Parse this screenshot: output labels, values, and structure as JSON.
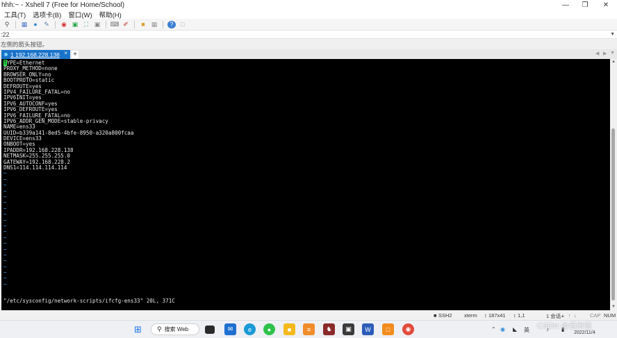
{
  "window": {
    "title": "hhh:~ - Xshell 7 (Free for Home/School)",
    "minimize": "—",
    "maximize": "❐",
    "close": "✕"
  },
  "menu": {
    "items": [
      "工具(T)",
      "选项卡(B)",
      "窗口(W)",
      "帮助(H)"
    ]
  },
  "toolbar": {
    "icons": [
      "search-icon",
      "new-session-icon",
      "globe-icon",
      "properties-icon",
      "xftp-icon",
      "xagent-icon",
      "fullscreen-icon",
      "lock-icon",
      "keyboard-icon",
      "compose-icon",
      "folder-icon",
      "layout-icon",
      "help-icon",
      "chat-icon"
    ]
  },
  "address": {
    "value": ":22"
  },
  "hint": {
    "text": "左侧的箭头按钮。"
  },
  "tabs": [
    {
      "label": "1 192.168.228.138",
      "close": "×"
    }
  ],
  "tab_add": "+",
  "terminal": {
    "cursor_char": "T",
    "first_line_rest": "YPE=Ethernet",
    "lines": [
      "PROXY_METHOD=none",
      "BROWSER_ONLY=no",
      "BOOTPROTO=static",
      "DEFROUTE=yes",
      "IPV4_FAILURE_FATAL=no",
      "IPV6INIT=yes",
      "IPV6_AUTOCONF=yes",
      "IPV6_DEFROUTE=yes",
      "IPV6_FAILURE_FATAL=no",
      "IPV6_ADDR_GEN_MODE=stable-privacy",
      "NAME=ens33",
      "UUID=b339a141-8ed5-4bfe-8950-a320a800fcaa",
      "DEVICE=ens33",
      "ONBOOT=yes",
      "IPADDR=192.168.228.138",
      "NETMASK=255.255.255.0",
      "GATEWAY=192.168.228.2",
      "DNS1=114.114.114.114"
    ],
    "tilde_count": 20,
    "status_message": "\"/etc/sysconfig/network-scripts/ifcfg-ens33\" 20L, 371C"
  },
  "statusbar": {
    "protocol": "SSH2",
    "terminal_type": "xterm",
    "size": "187x41",
    "cursor_pos": "1,1",
    "sessions": "1 会话",
    "caps": "CAP",
    "num": "NUM"
  },
  "taskbar": {
    "search_label": "搜索 Web",
    "ime": "英",
    "date": "2022/11/4",
    "watermark": "CSDN @佰卅强"
  }
}
